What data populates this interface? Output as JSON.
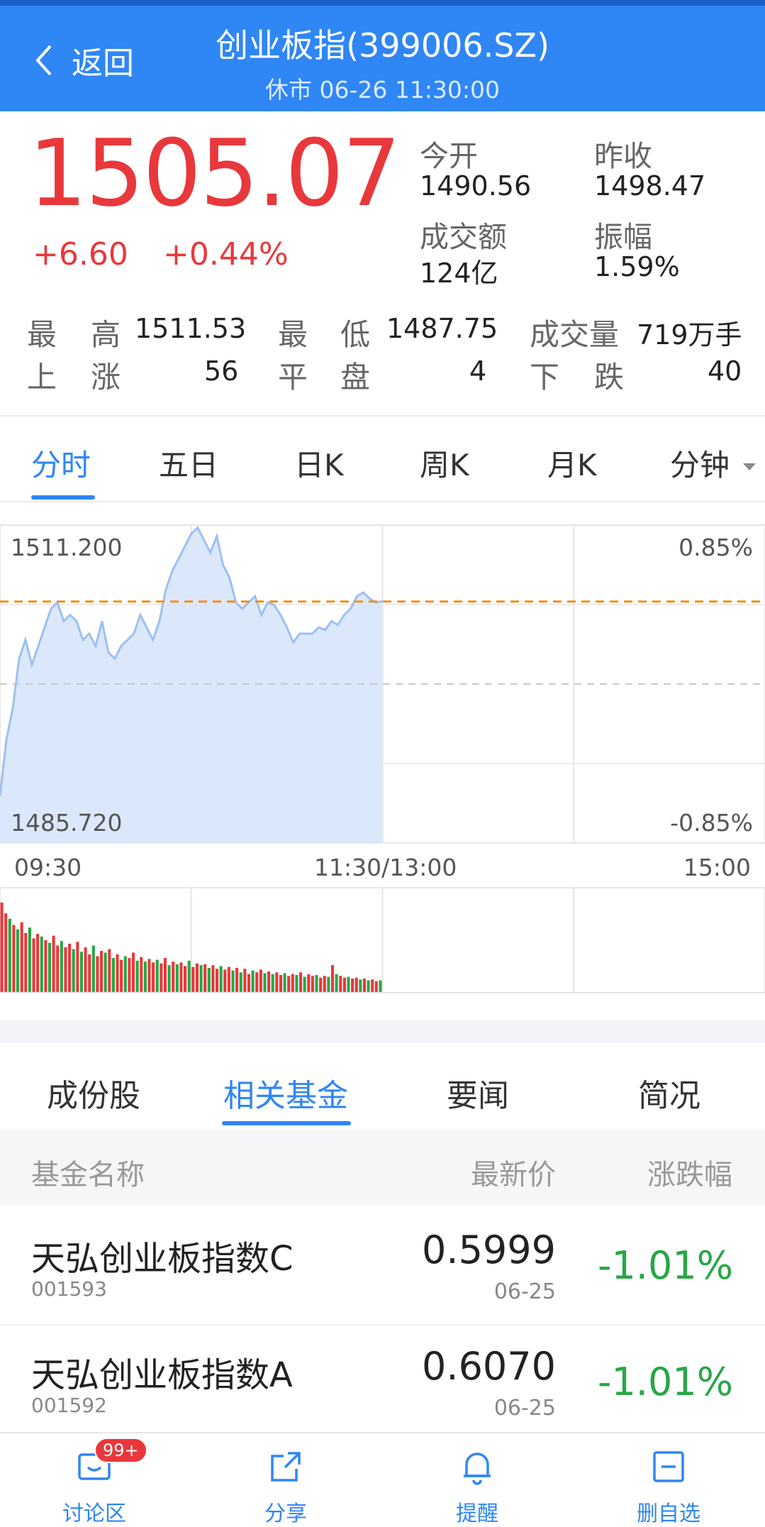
{
  "header": {
    "back_label": "返回",
    "title": "创业板指(399006.SZ)",
    "subtitle": "休市 06-26 11:30:00"
  },
  "quote": {
    "price": "1505.07",
    "change": "+6.60",
    "change_pct": "+0.44%",
    "open_label": "今开",
    "open_value": "1490.56",
    "prev_close_label": "昨收",
    "prev_close_value": "1498.47",
    "turnover_label": "成交额",
    "turnover_value": "124亿",
    "amplitude_label": "振幅",
    "amplitude_value": "1.59%"
  },
  "stats": {
    "high_label_1": "最",
    "high_label_2": "高",
    "high_value": "1511.53",
    "low_label_1": "最",
    "low_label_2": "低",
    "low_value": "1487.75",
    "volume_label": "成交量",
    "volume_value": "719万手",
    "up_label_1": "上",
    "up_label_2": "涨",
    "up_value": "56",
    "flat_label_1": "平",
    "flat_label_2": "盘",
    "flat_value": "4",
    "down_label_1": "下",
    "down_label_2": "跌",
    "down_value": "40"
  },
  "chart_tabs": [
    "分时",
    "五日",
    "日K",
    "周K",
    "月K",
    "分钟"
  ],
  "chart_labels": {
    "y_top": "1511.200",
    "y_bottom": "1485.720",
    "pct_top": "0.85%",
    "pct_bottom": "-0.85%",
    "t_start": "09:30",
    "t_mid": "11:30/13:00",
    "t_end": "15:00"
  },
  "chart_data": {
    "type": "area",
    "y_range": [
      1485.72,
      1511.2
    ],
    "prev_close": 1498.47,
    "last_price": 1505.07,
    "x_range_minutes": [
      0,
      240
    ],
    "x": [
      0,
      2,
      4,
      6,
      8,
      10,
      12,
      14,
      16,
      18,
      20,
      22,
      24,
      26,
      28,
      30,
      32,
      34,
      36,
      38,
      40,
      42,
      44,
      46,
      48,
      50,
      52,
      54,
      56,
      58,
      60,
      62,
      64,
      66,
      68,
      70,
      72,
      74,
      76,
      78,
      80,
      82,
      84,
      86,
      88,
      90,
      92,
      94,
      96,
      98,
      100,
      102,
      104,
      106,
      108,
      110,
      112,
      114,
      116,
      118,
      120
    ],
    "values": [
      1489.5,
      1494.0,
      1496.5,
      1500.5,
      1502.0,
      1500.0,
      1501.5,
      1503.0,
      1504.5,
      1505.0,
      1503.5,
      1504.0,
      1503.5,
      1502.0,
      1502.5,
      1501.5,
      1503.5,
      1501.0,
      1500.5,
      1501.5,
      1502.0,
      1502.5,
      1504.0,
      1503.0,
      1502.0,
      1503.5,
      1506.0,
      1507.5,
      1508.5,
      1509.5,
      1510.5,
      1511.0,
      1510.0,
      1509.0,
      1510.3,
      1508.0,
      1507.0,
      1505.0,
      1504.5,
      1505.0,
      1505.5,
      1504.0,
      1505.0,
      1504.8,
      1504.0,
      1503.0,
      1501.8,
      1502.5,
      1502.5,
      1502.5,
      1503.0,
      1502.8,
      1503.5,
      1503.2,
      1504.0,
      1504.5,
      1505.5,
      1505.8,
      1505.3,
      1505.0,
      1505.1
    ],
    "volume_bars": [
      100,
      88,
      82,
      75,
      70,
      78,
      66,
      72,
      60,
      65,
      62,
      58,
      55,
      63,
      52,
      57,
      50,
      54,
      48,
      56,
      45,
      50,
      42,
      52,
      40,
      46,
      44,
      48,
      38,
      42,
      36,
      40,
      38,
      44,
      35,
      39,
      34,
      37,
      33,
      36,
      32,
      38,
      30,
      34,
      31,
      33,
      29,
      35,
      28,
      32,
      30,
      31,
      27,
      30,
      26,
      29,
      25,
      28,
      24,
      27,
      22,
      26,
      20,
      24,
      22,
      25,
      21,
      23,
      20,
      22,
      19,
      21,
      18,
      20,
      19,
      22,
      17,
      20,
      18,
      19,
      16,
      18,
      17,
      30,
      20,
      18,
      16,
      17,
      15,
      16,
      14,
      15,
      13,
      14,
      12,
      13
    ],
    "volume_colors_pattern": [
      "red",
      "red",
      "green",
      "red",
      "green",
      "red",
      "red",
      "green"
    ]
  },
  "bottom_tabs": [
    "成份股",
    "相关基金",
    "要闻",
    "简况"
  ],
  "table": {
    "col_name": "基金名称",
    "col_price": "最新价",
    "col_change": "涨跌幅",
    "rows": [
      {
        "name": "天弘创业板指数C",
        "code": "001593",
        "price": "0.5999",
        "date": "06-25",
        "change": "-1.01%"
      },
      {
        "name": "天弘创业板指数A",
        "code": "001592",
        "price": "0.6070",
        "date": "06-25",
        "change": "-1.01%"
      }
    ]
  },
  "bottom_nav": {
    "badge": "99+",
    "items": [
      "讨论区",
      "分享",
      "提醒",
      "删自选"
    ]
  },
  "colors": {
    "brand": "#2f86f5",
    "up": "#e8383b",
    "down": "#27a745",
    "ref_line": "#f0901e"
  }
}
